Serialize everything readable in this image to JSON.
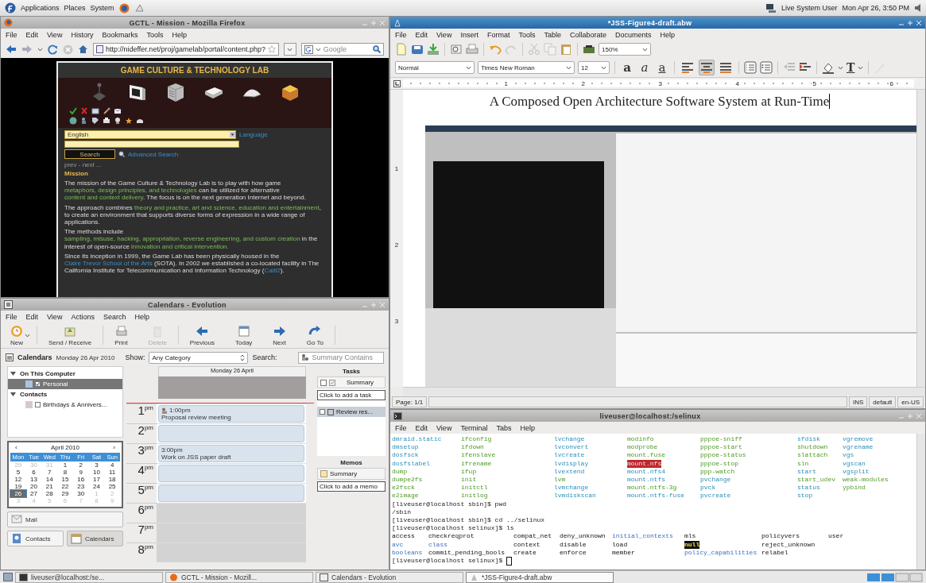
{
  "top_panel": {
    "menus": [
      "Applications",
      "Places",
      "System"
    ],
    "user": "Live System User",
    "clock": "Mon Apr 26,  3:50 PM"
  },
  "firefox": {
    "title": "GCTL - Mission - Mozilla Firefox",
    "active": false,
    "menu": [
      "File",
      "Edit",
      "View",
      "History",
      "Bookmarks",
      "Tools",
      "Help"
    ],
    "url": "http://nideffer.net/proj/gamelab/portal/content.php?",
    "search_placeholder": "Google",
    "page": {
      "heading": "GAME CULTURE & TECHNOLOGY LAB",
      "language_value": "English",
      "language_link": "Language",
      "search_button": "Search",
      "advanced_search": "Advanced Search",
      "pager": "prev - next ...",
      "section_title": "Mission",
      "paragraphs": [
        [
          {
            "text": "The mission of the Game Culture & Technology Lab is to play with how game ",
            "link": false
          },
          {
            "text": "metaphors, design principles, and technologies",
            "link": true
          },
          {
            "text": " can be utilized for alternative ",
            "link": false
          },
          {
            "text": "content and context delivery",
            "link": true
          },
          {
            "text": ". The focus is on the next generation Internet and beyond.",
            "link": false
          }
        ],
        [
          {
            "text": "The approach combines ",
            "link": false
          },
          {
            "text": "theory and practice, art and science, education and entertainment",
            "link": true
          },
          {
            "text": ", to create an environment that supports diverse forms of expression in a wide range of applications.",
            "link": false
          }
        ],
        [
          {
            "text": "The methods include ",
            "link": false
          },
          {
            "text": "sampling, misuse, hacking, appropriation, reverse engineering,",
            "link": true
          },
          {
            "text": " and custom creation",
            "link": true
          },
          {
            "text": " in the interest of open-source ",
            "link": false
          },
          {
            "text": "innovation and critical intervention.",
            "link": true
          }
        ],
        [
          {
            "text": "Since its inception in 1999, the Game Lab has been physically housed in the ",
            "link": false
          },
          {
            "text": "Claire Trevor School of the Arts",
            "link": true
          },
          {
            "text": " (SOTA). In 2002 we established a co-located facility in The California Institute for Telecommunication and Information Technology (",
            "link": false
          },
          {
            "text": "Calit2",
            "link": true
          },
          {
            "text": ").",
            "link": false
          }
        ]
      ]
    }
  },
  "evolution": {
    "title": "Calendars - Evolution",
    "active": false,
    "menu": [
      "File",
      "Edit",
      "View",
      "Actions",
      "Search",
      "Help"
    ],
    "toolbar": [
      {
        "kind": "new",
        "label": "New",
        "disabled": false
      },
      {
        "kind": "send",
        "label": "Send / Receive",
        "disabled": false
      },
      {
        "kind": "print",
        "label": "Print",
        "disabled": false
      },
      {
        "kind": "delete",
        "label": "Delete",
        "disabled": true
      },
      {
        "kind": "previous",
        "label": "Previous",
        "disabled": false
      },
      {
        "kind": "today",
        "label": "Today",
        "disabled": false
      },
      {
        "kind": "next",
        "label": "Next",
        "disabled": false
      },
      {
        "kind": "goto",
        "label": "Go To",
        "disabled": false
      }
    ],
    "header": {
      "title": "Calendars",
      "date": "Monday 26 Apr 2010",
      "show_label": "Show:",
      "category": "Any Category",
      "search_label": "Search:",
      "search_placeholder": "Summary Contains"
    },
    "sources": [
      {
        "name": "On This Computer",
        "expanded": true,
        "items": [
          {
            "name": "Personal",
            "checked": true,
            "selected": true,
            "color": "#a9c4de"
          }
        ]
      },
      {
        "name": "Contacts",
        "expanded": true,
        "items": [
          {
            "name": "Birthdays & Annivers...",
            "checked": false,
            "selected": false,
            "color": "#d8c8cc"
          }
        ]
      }
    ],
    "mini_calendar": {
      "month": "April 2010",
      "prev": "‹",
      "next": "›",
      "weekdays": [
        "Mon",
        "Tue",
        "Wed",
        "Thu",
        "Fri",
        "Sat",
        "Sun"
      ],
      "days": [
        {
          "day": "29",
          "outside": true,
          "selected": false
        },
        {
          "day": "30",
          "outside": true,
          "selected": false
        },
        {
          "day": "31",
          "outside": true,
          "selected": false
        },
        {
          "day": "1",
          "outside": false,
          "selected": false
        },
        {
          "day": "2",
          "outside": false,
          "selected": false
        },
        {
          "day": "3",
          "outside": false,
          "selected": false
        },
        {
          "day": "4",
          "outside": false,
          "selected": false
        },
        {
          "day": "5",
          "outside": false,
          "selected": false
        },
        {
          "day": "6",
          "outside": false,
          "selected": false
        },
        {
          "day": "7",
          "outside": false,
          "selected": false
        },
        {
          "day": "8",
          "outside": false,
          "selected": false
        },
        {
          "day": "9",
          "outside": false,
          "selected": false
        },
        {
          "day": "10",
          "outside": false,
          "selected": false
        },
        {
          "day": "11",
          "outside": false,
          "selected": false
        },
        {
          "day": "12",
          "outside": false,
          "selected": false
        },
        {
          "day": "13",
          "outside": false,
          "selected": false
        },
        {
          "day": "14",
          "outside": false,
          "selected": false
        },
        {
          "day": "15",
          "outside": false,
          "selected": false
        },
        {
          "day": "16",
          "outside": false,
          "selected": false
        },
        {
          "day": "17",
          "outside": false,
          "selected": false
        },
        {
          "day": "18",
          "outside": false,
          "selected": false
        },
        {
          "day": "19",
          "outside": false,
          "selected": false
        },
        {
          "day": "20",
          "outside": false,
          "selected": false
        },
        {
          "day": "21",
          "outside": false,
          "selected": false
        },
        {
          "day": "22",
          "outside": false,
          "selected": false
        },
        {
          "day": "23",
          "outside": false,
          "selected": false
        },
        {
          "day": "24",
          "outside": false,
          "selected": false
        },
        {
          "day": "25",
          "outside": false,
          "selected": false
        },
        {
          "day": "26",
          "outside": false,
          "selected": true
        },
        {
          "day": "27",
          "outside": false,
          "selected": false
        },
        {
          "day": "28",
          "outside": false,
          "selected": false
        },
        {
          "day": "29",
          "outside": false,
          "selected": false
        },
        {
          "day": "30",
          "outside": false,
          "selected": false
        },
        {
          "day": "1",
          "outside": true,
          "selected": false
        },
        {
          "day": "2",
          "outside": true,
          "selected": false
        },
        {
          "day": "3",
          "outside": true,
          "selected": false
        },
        {
          "day": "4",
          "outside": true,
          "selected": false
        },
        {
          "day": "5",
          "outside": true,
          "selected": false
        },
        {
          "day": "6",
          "outside": true,
          "selected": false
        },
        {
          "day": "7",
          "outside": true,
          "selected": false
        },
        {
          "day": "8",
          "outside": true,
          "selected": false
        },
        {
          "day": "9",
          "outside": true,
          "selected": false
        }
      ]
    },
    "switcher": [
      {
        "kind": "mail",
        "label": "Mail",
        "selected": false
      },
      {
        "kind": "contacts",
        "label": "Contacts",
        "selected": false
      },
      {
        "kind": "calendars",
        "label": "Calendars",
        "selected": true
      }
    ],
    "day_view": {
      "header": "Monday 26 April",
      "hours": [
        {
          "hour": "1",
          "suffix": "pm",
          "working": true,
          "busy": true,
          "events": [
            {
              "time": "1:00pm",
              "title": "Proposal review meeting",
              "meeting": true
            }
          ]
        },
        {
          "hour": "2",
          "suffix": "pm",
          "working": true,
          "busy": true
        },
        {
          "hour": "3",
          "suffix": "pm",
          "working": true,
          "busy": true,
          "events": [
            {
              "time": "3:00pm",
              "title": "Work on JSS paper draft",
              "meeting": false
            }
          ]
        },
        {
          "hour": "4",
          "suffix": "pm",
          "working": true,
          "busy": true
        },
        {
          "hour": "5",
          "suffix": "pm",
          "working": true,
          "busy": true
        },
        {
          "hour": "6",
          "suffix": "pm",
          "working": false,
          "busy": false
        },
        {
          "hour": "7",
          "suffix": "pm",
          "working": false,
          "busy": false
        },
        {
          "hour": "8",
          "suffix": "pm",
          "working": false,
          "busy": false
        }
      ]
    },
    "tasks": {
      "title": "Tasks",
      "column": "Summary",
      "add": "Click to add a task",
      "items": [
        {
          "title": "Review res...",
          "done": false
        }
      ]
    },
    "memos": {
      "title": "Memos",
      "column": "Summary",
      "add": "Click to add a memo"
    }
  },
  "abiword": {
    "title": "*JSS-Figure4-draft.abw",
    "active": true,
    "menu": [
      "File",
      "Edit",
      "View",
      "Insert",
      "Format",
      "Tools",
      "Table",
      "Collaborate",
      "Documents",
      "Help"
    ],
    "zoom": "150%",
    "style": "Normal",
    "font": "Times New Roman",
    "size": "12",
    "char_buttons": [
      {
        "kind": "bold",
        "glyph": "a"
      },
      {
        "kind": "italic",
        "glyph": "a"
      },
      {
        "kind": "underline",
        "glyph": "a"
      }
    ],
    "align": [
      {
        "kind": "left",
        "selected": false
      },
      {
        "kind": "center",
        "selected": true
      },
      {
        "kind": "justify",
        "selected": false
      }
    ],
    "text_color_glyph": "T",
    "ruler": [
      "1",
      "2",
      "3",
      "4",
      "5",
      "6"
    ],
    "side_ruler": [
      "1",
      "2",
      "3"
    ],
    "doc_title": "A Composed Open Architecture Software System at Run-Time",
    "status": {
      "page": "Page: 1/1",
      "mode": "INS",
      "style": "default",
      "lang": "en-US"
    }
  },
  "terminal": {
    "title": "liveuser@localhost:/selinux",
    "active": false,
    "menu": [
      "File",
      "Edit",
      "View",
      "Terminal",
      "Tabs",
      "Help"
    ],
    "listing1": [
      [
        {
          "text": "dmraid.static",
          "kind": "link"
        },
        {
          "text": "ifconfig",
          "kind": "exec"
        },
        {
          "text": "lvchange",
          "kind": "link"
        },
        {
          "text": "modinfo",
          "kind": "exec"
        },
        {
          "text": "pppoe-sniff",
          "kind": "exec"
        },
        {
          "text": "sfdisk",
          "kind": "link"
        },
        {
          "text": "vgremove",
          "kind": "link"
        }
      ],
      [
        {
          "text": "dmsetup",
          "kind": "link"
        },
        {
          "text": "ifdown",
          "kind": "exec"
        },
        {
          "text": "lvconvert",
          "kind": "link"
        },
        {
          "text": "modprobe",
          "kind": "exec"
        },
        {
          "text": "pppoe-start",
          "kind": "exec"
        },
        {
          "text": "shutdown",
          "kind": "exec"
        },
        {
          "text": "vgrename",
          "kind": "link"
        }
      ],
      [
        {
          "text": "dosfsck",
          "kind": "link"
        },
        {
          "text": "ifenslave",
          "kind": "exec"
        },
        {
          "text": "lvcreate",
          "kind": "link"
        },
        {
          "text": "mount.fuse",
          "kind": "exec"
        },
        {
          "text": "pppoe-status",
          "kind": "exec"
        },
        {
          "text": "slattach",
          "kind": "exec"
        },
        {
          "text": "vgs",
          "kind": "link"
        }
      ],
      [
        {
          "text": "dosfslabel",
          "kind": "link"
        },
        {
          "text": "ifrename",
          "kind": "exec"
        },
        {
          "text": "lvdisplay",
          "kind": "link"
        },
        {
          "text": "mount.nfs",
          "kind": "orphan"
        },
        {
          "text": "pppoe-stop",
          "kind": "exec"
        },
        {
          "text": "sln",
          "kind": "exec"
        },
        {
          "text": "vgscan",
          "kind": "link"
        }
      ],
      [
        {
          "text": "dump",
          "kind": "exec"
        },
        {
          "text": "ifup",
          "kind": "exec"
        },
        {
          "text": "lvextend",
          "kind": "link"
        },
        {
          "text": "mount.nfs4",
          "kind": "link"
        },
        {
          "text": "ppp-watch",
          "kind": "exec"
        },
        {
          "text": "start",
          "kind": "link"
        },
        {
          "text": "vgsplit",
          "kind": "link"
        }
      ],
      [
        {
          "text": "dumpe2fs",
          "kind": "exec"
        },
        {
          "text": "init",
          "kind": "exec"
        },
        {
          "text": "lvm",
          "kind": "exec"
        },
        {
          "text": "mount.ntfs",
          "kind": "link"
        },
        {
          "text": "pvchange",
          "kind": "link"
        },
        {
          "text": "start_udev",
          "kind": "exec"
        },
        {
          "text": "weak-modules",
          "kind": "exec"
        }
      ],
      [
        {
          "text": "e2fsck",
          "kind": "exec"
        },
        {
          "text": "initctl",
          "kind": "exec"
        },
        {
          "text": "lvmchange",
          "kind": "link"
        },
        {
          "text": "mount.ntfs-3g",
          "kind": "exec"
        },
        {
          "text": "pvck",
          "kind": "link"
        },
        {
          "text": "status",
          "kind": "link"
        },
        {
          "text": "ypbind",
          "kind": "exec"
        }
      ],
      [
        {
          "text": "e2image",
          "kind": "exec"
        },
        {
          "text": "initlog",
          "kind": "exec"
        },
        {
          "text": "lvmdiskscan",
          "kind": "link"
        },
        {
          "text": "mount.ntfs-fuse",
          "kind": "link"
        },
        {
          "text": "pvcreate",
          "kind": "link"
        },
        {
          "text": "stop",
          "kind": "link"
        }
      ]
    ],
    "lines": [
      "[liveuser@localhost sbin]$ pwd",
      "/sbin",
      "[liveuser@localhost sbin]$ cd ../selinux",
      "[liveuser@localhost selinux]$ ls"
    ],
    "listing2": [
      [
        {
          "text": "access",
          "kind": "file"
        },
        {
          "text": "checkreqprot",
          "kind": "file"
        },
        {
          "text": "compat_net",
          "kind": "file"
        },
        {
          "text": "deny_unknown",
          "kind": "file"
        },
        {
          "text": "initial_contexts",
          "kind": "dir"
        },
        {
          "text": "mls",
          "kind": "file"
        },
        {
          "text": "policyvers",
          "kind": "file"
        },
        {
          "text": "user",
          "kind": "file"
        }
      ],
      [
        {
          "text": "avc",
          "kind": "dir"
        },
        {
          "text": "class",
          "kind": "dir"
        },
        {
          "text": "context",
          "kind": "file"
        },
        {
          "text": "disable",
          "kind": "file"
        },
        {
          "text": "load",
          "kind": "file"
        },
        {
          "text": "null",
          "kind": "device"
        },
        {
          "text": "reject_unknown",
          "kind": "file"
        }
      ],
      [
        {
          "text": "booleans",
          "kind": "dir"
        },
        {
          "text": "commit_pending_bools",
          "kind": "file"
        },
        {
          "text": "create",
          "kind": "file"
        },
        {
          "text": "enforce",
          "kind": "file"
        },
        {
          "text": "member",
          "kind": "file"
        },
        {
          "text": "policy_capabilities",
          "kind": "dir"
        },
        {
          "text": "relabel",
          "kind": "file"
        }
      ]
    ],
    "prompt": "[liveuser@localhost selinux]$ "
  },
  "taskbar": {
    "tasks": [
      {
        "kind": "terminal",
        "label": "liveuser@localhost:/se...",
        "selected": false
      },
      {
        "kind": "browser",
        "label": "GCTL - Mission - Mozill...",
        "selected": false
      },
      {
        "kind": "calendar",
        "label": "Calendars - Evolution",
        "selected": false
      },
      {
        "kind": "writer",
        "label": "*JSS-Figure4-draft.abw",
        "selected": true
      }
    ]
  }
}
